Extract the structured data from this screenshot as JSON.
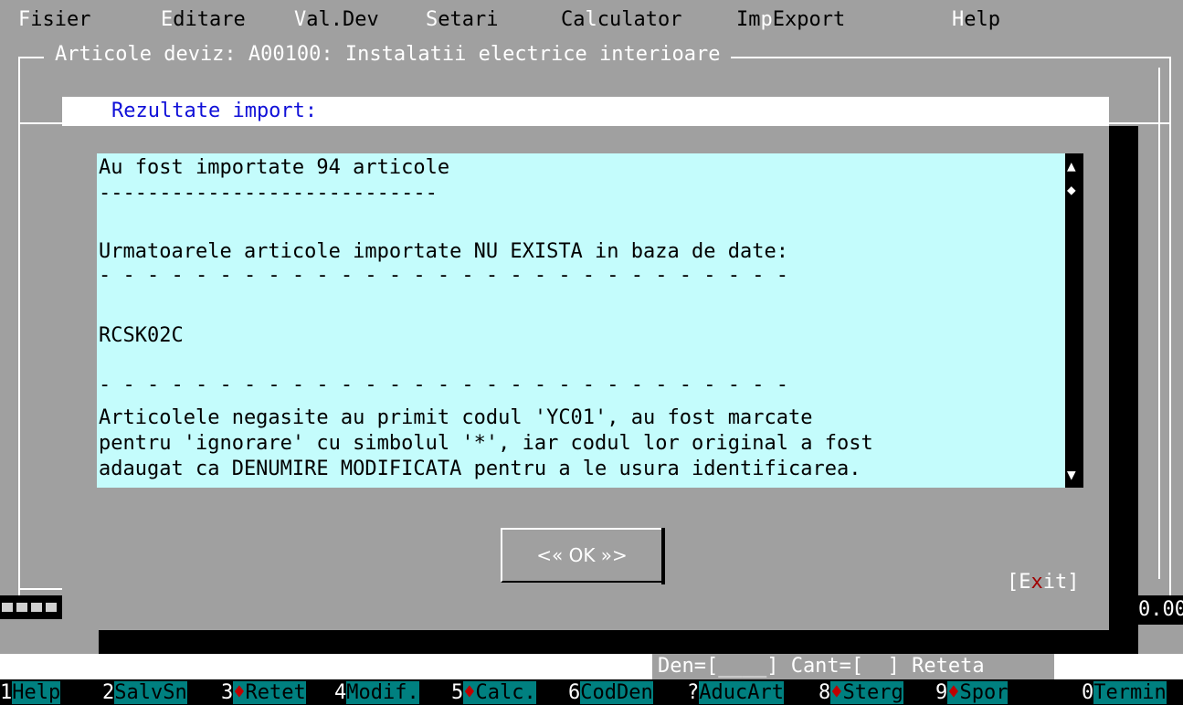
{
  "menu": {
    "items": [
      {
        "hot": "F",
        "rest": "isier"
      },
      {
        "hot": "E",
        "rest": "ditare"
      },
      {
        "hot": "V",
        "rest": "al.Dev"
      },
      {
        "hot": "S",
        "rest": "etari"
      },
      {
        "pre": "Ca",
        "hot": "l",
        "rest": "culator"
      },
      {
        "pre": "Im",
        "hot": "p",
        "rest": "Export"
      },
      {
        "hot": "H",
        "rest": "elp"
      }
    ]
  },
  "window": {
    "title": "Articole deviz: A00100: Instalatii electrice interioare"
  },
  "dialog": {
    "title": "Rezultate import:",
    "lines": [
      "Au fost importate 94 articole",
      "----------------------------",
      "",
      "Urmatoarele articole importate NU EXISTA in baza de date:",
      "- - - - - - - - - - - - - - - - - - - - - - - - - - - - -",
      "",
      "RCSK02C",
      "",
      "- - - - - - - - - - - - - - - - - - - - - - - - - - - - -",
      "Articolele negasite au primit codul 'YC01', au fost marcate",
      "pentru 'ignorare' cu simbolul '*', iar codul lor original a fost",
      "adaugat ca DENUMIRE MODIFICATA pentru a le usura identificarea."
    ],
    "ok_label": "<« OK »>",
    "exit_pre": "[E",
    "exit_hot": "x",
    "exit_post": "it]",
    "scroll_up": "▲",
    "scroll_thumb": "◆",
    "scroll_down": "▼"
  },
  "right_value": "0.00",
  "status": {
    "fields": "Den=[____] Cant=[  ] Reteta"
  },
  "fkeys": [
    {
      "num": "1",
      "label": "Help"
    },
    {
      "num": "2",
      "label": "SalvSn"
    },
    {
      "num": "3",
      "label": "Retet",
      "mark": "♦"
    },
    {
      "num": "4",
      "label": "Modif."
    },
    {
      "num": "5",
      "label": "Calc.",
      "mark": "♦"
    },
    {
      "num": "6",
      "label": "CodDen"
    },
    {
      "num": "?",
      "label": "AducArt"
    },
    {
      "num": "8",
      "label": "Sterg",
      "mark": "♦"
    },
    {
      "num": "9",
      "label": "Spor",
      "mark": "♦"
    },
    {
      "num": "0",
      "label": "Termin"
    }
  ],
  "colors": {
    "desktop": "#a0a0a0",
    "text_area": "#c4fcfc",
    "title_blue": "#1010d8",
    "fkey_teal": "#008080",
    "marker_red": "#c00000"
  }
}
